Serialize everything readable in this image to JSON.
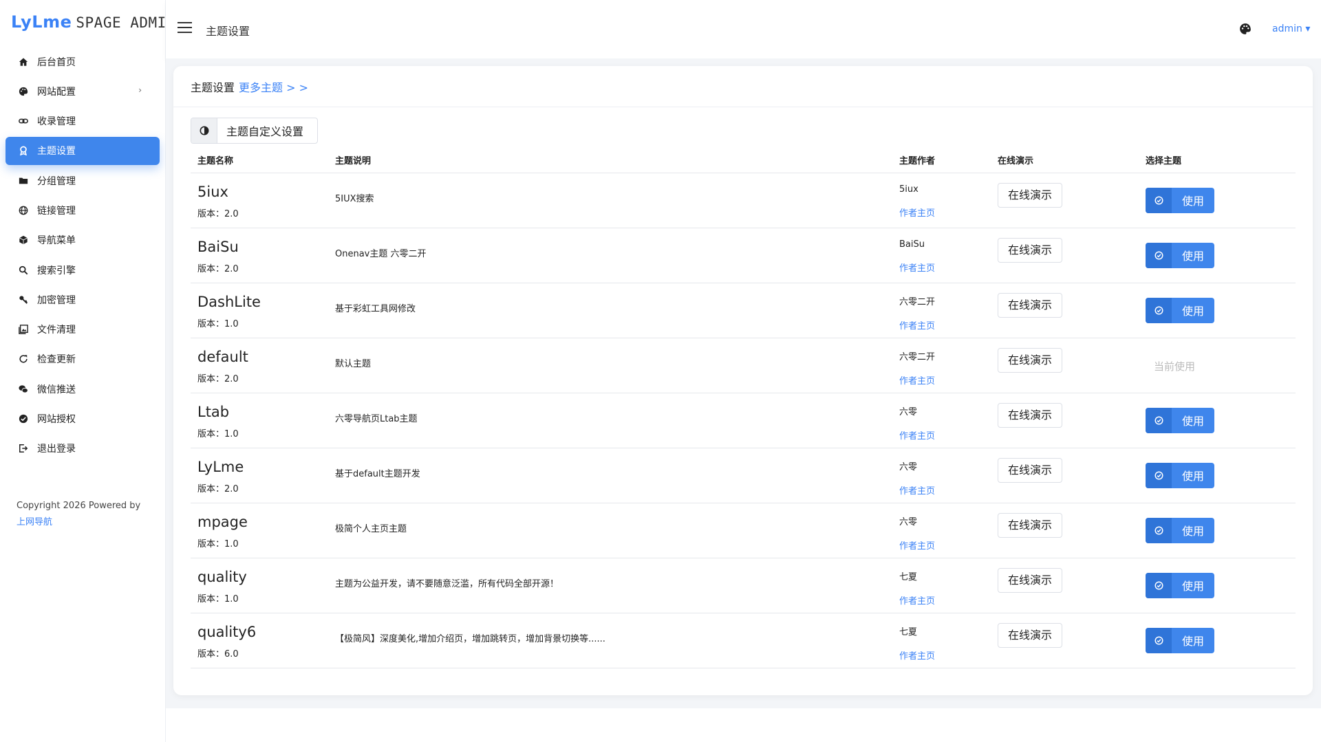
{
  "app": {
    "brand": "LyLme",
    "brand_rest": "SPAGE ADMIN"
  },
  "sidebar": {
    "items": [
      {
        "label": "后台首页",
        "icon": "home-icon"
      },
      {
        "label": "网站配置",
        "icon": "palette-icon",
        "has_arrow": true,
        "arrow": "›"
      },
      {
        "label": "收录管理",
        "icon": "link-icon"
      },
      {
        "label": "主题设置",
        "icon": "theme-icon",
        "active": true
      },
      {
        "label": "分组管理",
        "icon": "folder-icon"
      },
      {
        "label": "链接管理",
        "icon": "globe-icon"
      },
      {
        "label": "导航菜单",
        "icon": "cube-icon"
      },
      {
        "label": "搜索引擎",
        "icon": "search-icon"
      },
      {
        "label": "加密管理",
        "icon": "key-icon"
      },
      {
        "label": "文件清理",
        "icon": "image-icon"
      },
      {
        "label": "检查更新",
        "icon": "refresh-icon"
      },
      {
        "label": "微信推送",
        "icon": "wechat-icon"
      },
      {
        "label": "网站授权",
        "icon": "check-circle-icon"
      },
      {
        "label": "退出登录",
        "icon": "logout-icon"
      }
    ],
    "copyright": "Copyright 2026 Powered by",
    "copyright_link": "上网导航"
  },
  "topbar": {
    "title": "主题设置",
    "user": "admin ▾"
  },
  "card": {
    "title": "主题设置",
    "more_link": "更多主题 > >",
    "custom_button": "主题自定义设置",
    "columns": [
      "主题名称",
      "主题说明",
      "主题作者",
      "在线演示",
      "选择主题"
    ],
    "version_prefix": "版本：",
    "demo_label": "在线演示",
    "use_label": "使用",
    "current_label": "当前使用",
    "home_label": "作者主页"
  },
  "themes": [
    {
      "name": "5iux",
      "version": "2.0",
      "desc": "5IUX搜索",
      "author": "5iux",
      "current": false
    },
    {
      "name": "BaiSu",
      "version": "2.0",
      "desc": "Onenav主题 六零二开",
      "author": "BaiSu",
      "current": false
    },
    {
      "name": "DashLite",
      "version": "1.0",
      "desc": "基于彩虹工具网修改",
      "author": "六零二开",
      "current": false
    },
    {
      "name": "default",
      "version": "2.0",
      "desc": "默认主题",
      "author": "六零二开",
      "current": true
    },
    {
      "name": "Ltab",
      "version": "1.0",
      "desc": "六零导航页Ltab主题",
      "author": "六零",
      "current": false
    },
    {
      "name": "LyLme",
      "version": "2.0",
      "desc": "基于default主题开发",
      "author": "六零",
      "current": false
    },
    {
      "name": "mpage",
      "version": "1.0",
      "desc": "极简个人主页主题",
      "author": "六零",
      "current": false
    },
    {
      "name": "quality",
      "version": "1.0",
      "desc": "主题为公益开发，请不要随意泛滥，所有代码全部开源！",
      "author": "七夏",
      "current": false
    },
    {
      "name": "quality6",
      "version": "6.0",
      "desc": "【极简风】深度美化,增加介绍页，增加跳转页，增加背景切换等......",
      "author": "七夏",
      "current": false
    }
  ],
  "colors": {
    "accent": "#3f86ec",
    "link": "#3b82f6"
  }
}
